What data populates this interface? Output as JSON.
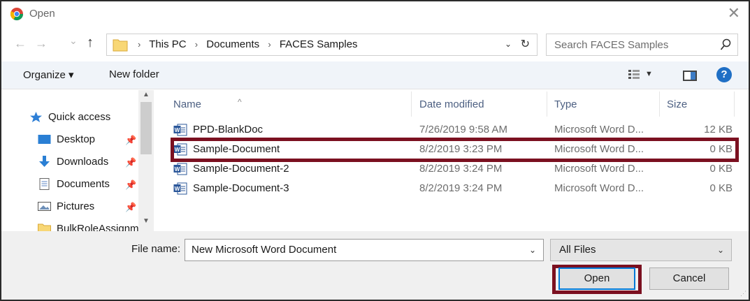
{
  "window": {
    "title": "Open",
    "close_glyph": "✕"
  },
  "nav": {
    "back_glyph": "←",
    "forward_glyph": "→",
    "recent_glyph": "⌄",
    "up_glyph": "↑",
    "breadcrumb": [
      "This PC",
      "Documents",
      "FACES Samples"
    ],
    "sep_glyph": "›",
    "dropdown_glyph": "⌄",
    "refresh_glyph": "↻"
  },
  "search": {
    "placeholder": "Search FACES Samples"
  },
  "toolbar": {
    "organize": "Organize ▾",
    "new_folder": "New folder",
    "view_dropdown_glyph": "▼",
    "help_glyph": "?"
  },
  "sidebar": {
    "items": [
      {
        "label": "Quick access",
        "icon": "star-icon",
        "pinned": false
      },
      {
        "label": "Desktop",
        "icon": "desktop-icon",
        "pinned": true
      },
      {
        "label": "Downloads",
        "icon": "downloads-icon",
        "pinned": true
      },
      {
        "label": "Documents",
        "icon": "documents-icon",
        "pinned": true
      },
      {
        "label": "Pictures",
        "icon": "pictures-icon",
        "pinned": true
      },
      {
        "label": "BulkRoleAssignm",
        "icon": "folder-icon",
        "pinned": false
      }
    ],
    "pin_glyph": "📌"
  },
  "columns": {
    "name": "Name",
    "date": "Date modified",
    "type": "Type",
    "size": "Size",
    "sort_glyph": "^"
  },
  "files": [
    {
      "name": "PPD-BlankDoc",
      "date": "7/26/2019 9:58 AM",
      "type": "Microsoft Word D...",
      "size": "12 KB"
    },
    {
      "name": "Sample-Document",
      "date": "8/2/2019 3:23 PM",
      "type": "Microsoft Word D...",
      "size": "0 KB"
    },
    {
      "name": "Sample-Document-2",
      "date": "8/2/2019 3:24 PM",
      "type": "Microsoft Word D...",
      "size": "0 KB"
    },
    {
      "name": "Sample-Document-3",
      "date": "8/2/2019 3:24 PM",
      "type": "Microsoft Word D...",
      "size": "0 KB"
    }
  ],
  "bottom": {
    "file_name_label": "File name:",
    "file_name_value": "New Microsoft Word Document",
    "dropdown_glyph": "⌄",
    "filter_value": "All Files",
    "open_label": "Open",
    "cancel_label": "Cancel",
    "grip_glyph": "⋰"
  },
  "colors": {
    "highlight": "#7b1020",
    "accent": "#0078d7",
    "toolbar_bg": "#f0f4f9",
    "word_icon": "#2b579a"
  }
}
